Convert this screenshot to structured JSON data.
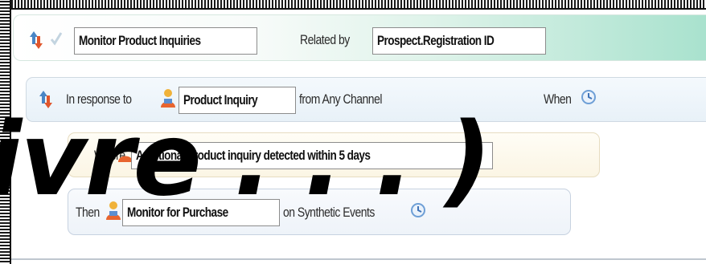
{
  "header": {
    "rule_name": "Monitor Product Inquiries",
    "related_by_label": "Related by",
    "related_by_value": "Prospect.Registration ID"
  },
  "response_row": {
    "prefix": "In response to",
    "event": "Product Inquiry",
    "source": "from Any Channel",
    "when_label": "When"
  },
  "where_row": {
    "label": "Where",
    "condition": "Additional  product inquiry detected within 5 days"
  },
  "then_row": {
    "label": "Then",
    "action": "Monitor for Purchase",
    "target": "on Synthetic Events"
  },
  "overlay_text": "ivre . . . )",
  "icons": [
    "updown-arrow-icon",
    "check-icon",
    "person-icon",
    "clock-icon"
  ],
  "colors": {
    "header_gradient_end": "#a9e2ce",
    "where_bg": "#fbf5e4",
    "then_bg": "#eef3f9",
    "field_border": "#8c8c8c"
  }
}
